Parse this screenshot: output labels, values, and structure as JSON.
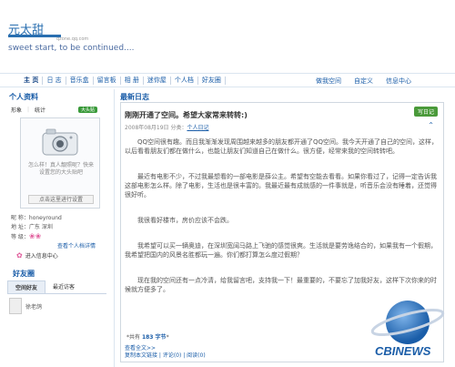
{
  "header": {
    "site_title": "元太甜",
    "qzone_url": "qzone.qq.com",
    "motto": "sweet start, to be continued...."
  },
  "nav": {
    "items": [
      "主 页",
      "日 志",
      "音乐盒",
      "留言板",
      "相 册",
      "迷你屋",
      "个人档",
      "好友圈"
    ],
    "right": [
      "做我空间",
      "自定义",
      "信息中心"
    ]
  },
  "profile": {
    "title": "个人资料",
    "tabs": [
      "形象",
      "统计"
    ],
    "badge": "大头贴",
    "avatar_text": "怎么样！真人靓照呢？快来设置您的大头贴吧",
    "avatar_link": "点击这里进行设置",
    "nickname": "昵 称：honeyround",
    "location": "地 址：广东 深圳",
    "level_label": "等 级：",
    "view_profile": "查看个人档详情",
    "entry_center": "进入信息中心"
  },
  "friends": {
    "title": "好友圈",
    "tabs": [
      "空间好友",
      "最近访客"
    ],
    "friend_name": "徐老鸽"
  },
  "blog": {
    "header": "最新日志",
    "title": "刚刚开通了空间。希望大家常来转转:)",
    "new_post": "写日记",
    "meta": "2008年08月19日   分类：",
    "category": "个人日记",
    "paragraphs": [
      "QQ空间很有趣。而且我渐渐发现周围越来越多的朋友都开通了QQ空间。我今天开通了自己的空间，这样，以后看看朋友们都在做什么，也能让朋友们知道自己在做什么。很方便，经常来我的空间转转吧。",
      "最近有电影不少，不过我最想看的一部电影是薛公主。希望有空能去看看。如果你看过了，记得一定告诉我这部电影怎么样。除了电影，生活也是很丰富的。我最近最有成就感的一件事就是，听音乐会没有睡着，还觉得很好听。",
      "我很看好楼市，房价应该不会跌。",
      "我希望可以买一辆奥迪，在深圳宽阔马路上飞驰的感觉很爽。生活就是要劳逸结合的，如果我有一个假期，我希望把国内的风景名胜都玩一遍。你们都打算怎么度过假期？",
      "现在我的空间还有一点冷清，给我留言吧，支持我一下！最重要的，不要忘了加我好友，这样下次你来的时候就方便多了。"
    ],
    "more": "共有",
    "more_count": "183 字节",
    "footer_links": [
      "查看全文>>",
      "复制本文链接 | 评论(0) | 阅读(0)"
    ]
  },
  "logo_text": "CBINEWS"
}
